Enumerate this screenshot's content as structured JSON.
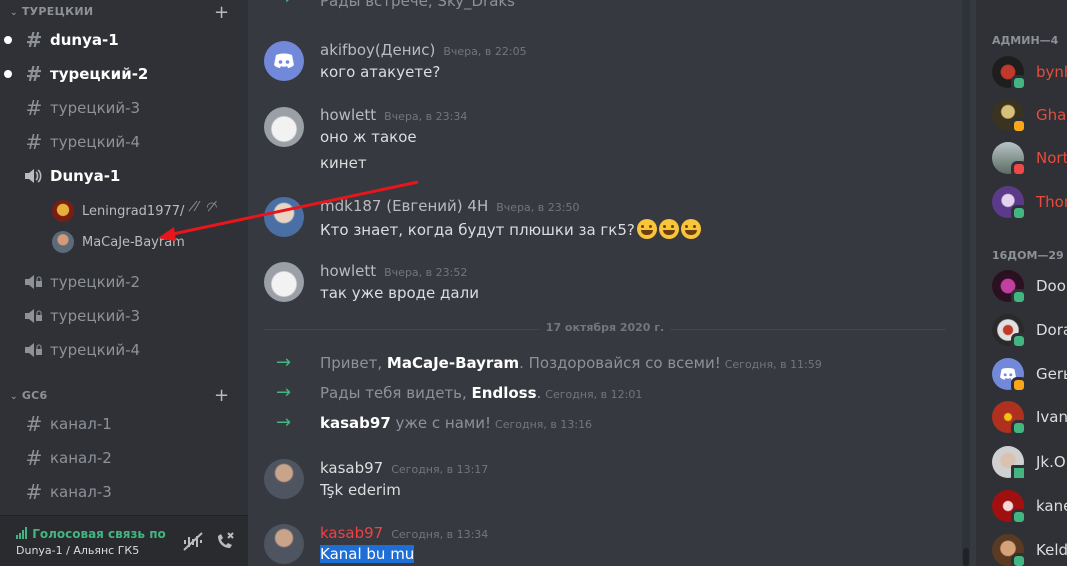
{
  "sidebar": {
    "category_turkish": "ТУРЕЦКИИ",
    "category_gc6": "GC6",
    "text_channels": [
      {
        "label": "dunya-1",
        "unread": true
      },
      {
        "label": "турецкий-2",
        "unread": true
      },
      {
        "label": "турецкий-3",
        "unread": false
      },
      {
        "label": "турецкий-4",
        "unread": false
      }
    ],
    "voice_channel_active": "Dunya-1",
    "voice_users": [
      "Leningrad1977/",
      "MaCaJe-Bayram"
    ],
    "voice_channels": [
      "турецкий-2",
      "турецкий-3",
      "турецкий-4"
    ],
    "gc6_channels": [
      "канал-1",
      "канал-2",
      "канал-3"
    ]
  },
  "voicebar": {
    "title": "Голосовая связь подключена",
    "subtitle": "Dunya-1 / Альянс ГК5"
  },
  "chat": {
    "top_partial": "Рады встрече, Sky_Draks",
    "messages": [
      {
        "author": "akifboy(Денис)",
        "time": "Вчера, в 22:05",
        "lines": [
          "кого атакуете?"
        ]
      },
      {
        "author": "howlett",
        "time": "Вчера, в 23:34",
        "lines": [
          "оно ж такое",
          "кинет"
        ]
      },
      {
        "author": "mdk187 (Евгений) 4H",
        "time": "Вчера, в 23:50",
        "lines": [
          "Кто знает, когда будут плюшки за гк5?"
        ]
      },
      {
        "author": "howlett",
        "time": "Вчера, в 23:52",
        "lines": [
          "так уже вроде дали"
        ]
      }
    ],
    "date_divider": "17 октября 2020 г.",
    "system": [
      {
        "pre": "Привет, ",
        "name": "MaCaJe-Bayram",
        "post": ". Поздоровайся со всеми!",
        "time": "Сегодня, в 11:59"
      },
      {
        "pre": "Рады тебя видеть, ",
        "name": "Endloss",
        "post": ".",
        "time": "Сегодня, в 12:01"
      },
      {
        "pre": "",
        "name": "kasab97",
        "post": " уже с нами!",
        "time": "Сегодня, в 13:16"
      }
    ],
    "kasab1": {
      "author": "kasab97",
      "time": "Сегодня, в 13:17",
      "line": "Tşk ederim"
    },
    "kasab2": {
      "author": "kasab97",
      "time": "Сегодня, в 13:34",
      "line": "Kanal bu mu"
    }
  },
  "members": {
    "admin_header": "АДМИН—4",
    "admins": [
      {
        "name": "bynh",
        "color": "#e74c3c",
        "status": "online"
      },
      {
        "name": "Ghai",
        "color": "#e74c3c",
        "status": "idle"
      },
      {
        "name": "Nort",
        "color": "#e74c3c",
        "status": "dnd"
      },
      {
        "name": "Thor",
        "color": "#e74c3c",
        "status": "online"
      }
    ],
    "home_header": "16ДОМ—29",
    "home": [
      {
        "name": "Door",
        "color": "#dcddde",
        "status": "online"
      },
      {
        "name": "Dora",
        "color": "#dcddde",
        "status": "online"
      },
      {
        "name": "Gerь",
        "color": "#dcddde",
        "status": "idle"
      },
      {
        "name": "IvanV",
        "color": "#dcddde",
        "status": "online"
      },
      {
        "name": "Jk.Ol",
        "color": "#dcddde",
        "status": "mobile"
      },
      {
        "name": "kane",
        "color": "#dcddde",
        "status": "online"
      },
      {
        "name": "Keld",
        "color": "#dcddde",
        "status": "online"
      }
    ]
  },
  "colors": {
    "online": "#43b581",
    "idle": "#faa61a",
    "dnd": "#f04747",
    "mention_red": "#e74c3c",
    "selection": "#1e6ed6"
  }
}
